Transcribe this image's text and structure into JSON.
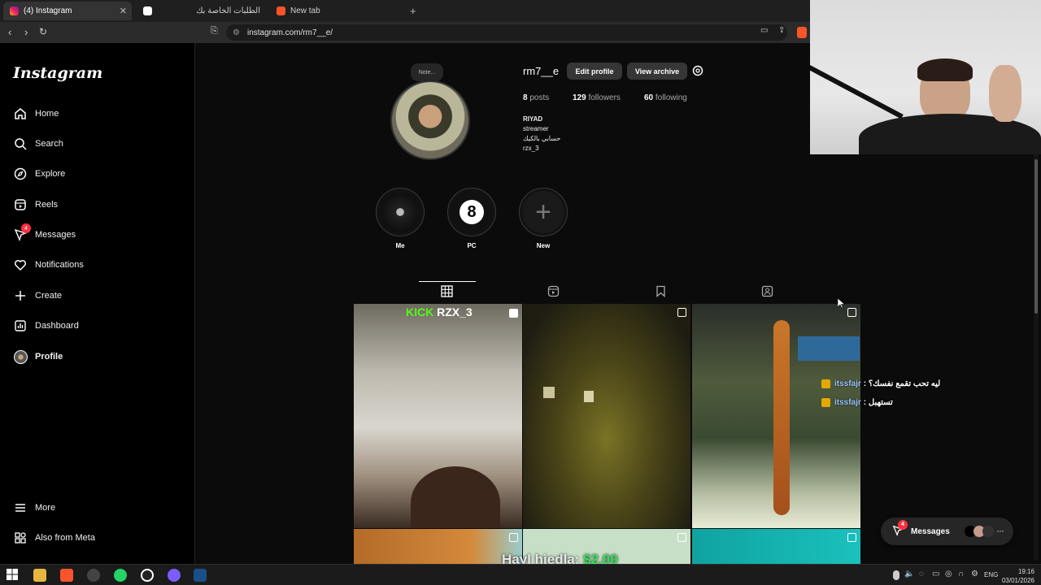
{
  "browser": {
    "tabs": [
      {
        "label": "(4) Instagram",
        "active": true
      },
      {
        "label": "الطلبات الخاصة بك",
        "active": false
      },
      {
        "label": "New tab",
        "active": false
      }
    ],
    "new_tab": "+",
    "url": "instagram.com/rm7__e/"
  },
  "sidebar": {
    "logo": "Instagram",
    "items": [
      {
        "label": "Home",
        "icon": "home-icon"
      },
      {
        "label": "Search",
        "icon": "search-icon"
      },
      {
        "label": "Explore",
        "icon": "compass-icon"
      },
      {
        "label": "Reels",
        "icon": "reels-icon"
      },
      {
        "label": "Messages",
        "icon": "messenger-icon",
        "badge": "4"
      },
      {
        "label": "Notifications",
        "icon": "heart-icon"
      },
      {
        "label": "Create",
        "icon": "plus-icon"
      },
      {
        "label": "Dashboard",
        "icon": "dashboard-icon"
      },
      {
        "label": "Profile",
        "icon": "avatar-icon"
      }
    ],
    "more": "More",
    "meta": "Also from Meta"
  },
  "profile": {
    "note": "Note...",
    "username": "rm7__e",
    "edit_profile": "Edit profile",
    "view_archive": "View archive",
    "posts_count": "8",
    "posts_label": "posts",
    "followers_count": "129",
    "followers_label": "followers",
    "following_count": "60",
    "following_label": "following",
    "bio": [
      "RIYAD",
      "streamer",
      "حسابي بالكيك",
      "rzx_3"
    ]
  },
  "highlights": [
    {
      "label": "Me"
    },
    {
      "label": "PC",
      "glyph": "8"
    },
    {
      "label": "New",
      "glyph": "+"
    }
  ],
  "post_overlay_text": {
    "kick": "KICK",
    "handle": "RZX_3"
  },
  "chat": [
    {
      "user": "itssfajr",
      "sep": ":",
      "msg": "ليه تحب تقمع نفسك؟"
    },
    {
      "user": "itssfajr",
      "sep": ":",
      "msg": "تستهبل"
    }
  ],
  "messages_pill": {
    "label": "Messages",
    "badge": "4",
    "more": "···"
  },
  "donation": {
    "text": "Hayl hiedla:",
    "amount": "$2.00"
  },
  "taskbar": {
    "lang": "ENG",
    "time": "19:16",
    "date": "03/01/2026"
  },
  "colors": {
    "accent": "#0095f6",
    "badge": "#ff3040",
    "donation": "#35e05a"
  }
}
